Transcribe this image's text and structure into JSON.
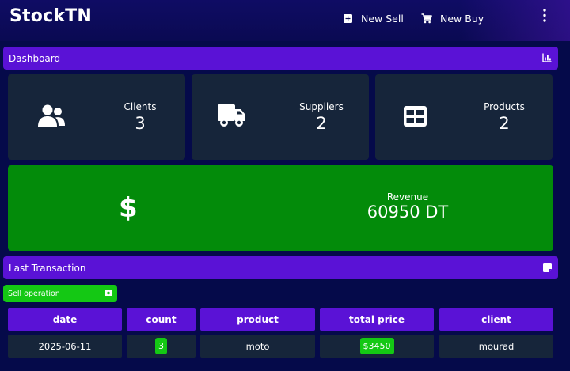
{
  "app": {
    "title": "StockTN"
  },
  "header": {
    "actions": [
      {
        "label": "New Sell",
        "icon": "plus-square-icon"
      },
      {
        "label": "New Buy",
        "icon": "cart-icon"
      }
    ],
    "menu_icon": "kebab-menu-icon"
  },
  "dashboard": {
    "title": "Dashboard",
    "icon": "bar-chart-icon",
    "stats": [
      {
        "label": "Clients",
        "value": "3",
        "icon": "users-icon"
      },
      {
        "label": "Suppliers",
        "value": "2",
        "icon": "truck-icon"
      },
      {
        "label": "Products",
        "value": "2",
        "icon": "grid-icon"
      }
    ],
    "revenue": {
      "label": "Revenue",
      "value": "60950 DT",
      "icon": "dollar-icon"
    }
  },
  "last_transaction": {
    "title": "Last Transaction",
    "icon": "note-icon",
    "operation_label": "Sell operation",
    "operation_icon": "cash-icon",
    "columns": [
      "date",
      "count",
      "product",
      "total price",
      "client"
    ],
    "row": {
      "date": "2025-06-11",
      "count": "3",
      "product": "moto",
      "total_price": "$3450",
      "client": "mourad"
    }
  },
  "colors": {
    "background": "#050a4a",
    "accent": "#5a12d6",
    "card": "#16253a",
    "success": "#038b0a",
    "badge": "#14c814"
  }
}
